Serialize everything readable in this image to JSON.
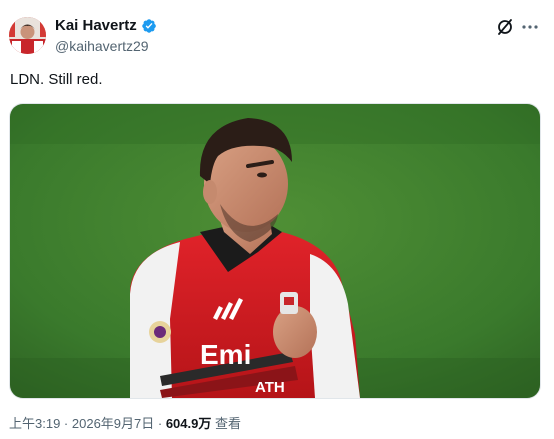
{
  "author": {
    "display_name": "Kai Havertz",
    "handle": "@kaihavertz29",
    "verified": true,
    "verified_color": "#1d9bf0"
  },
  "tweet": {
    "text": "LDN. Still red."
  },
  "media": {
    "kit_text": "Emi",
    "kit_text_2": "ATH",
    "accent_red": "#d7191f",
    "pitch_green": "#3a7a2c"
  },
  "meta": {
    "time": "上午3:19",
    "sep1": " · ",
    "date": "2026年9月7日",
    "sep2": " · ",
    "views": "604.9万",
    "views_label": " 查看"
  },
  "icons": {
    "grok": "grok-icon",
    "more": "more-icon",
    "verified": "verified-badge-icon"
  }
}
